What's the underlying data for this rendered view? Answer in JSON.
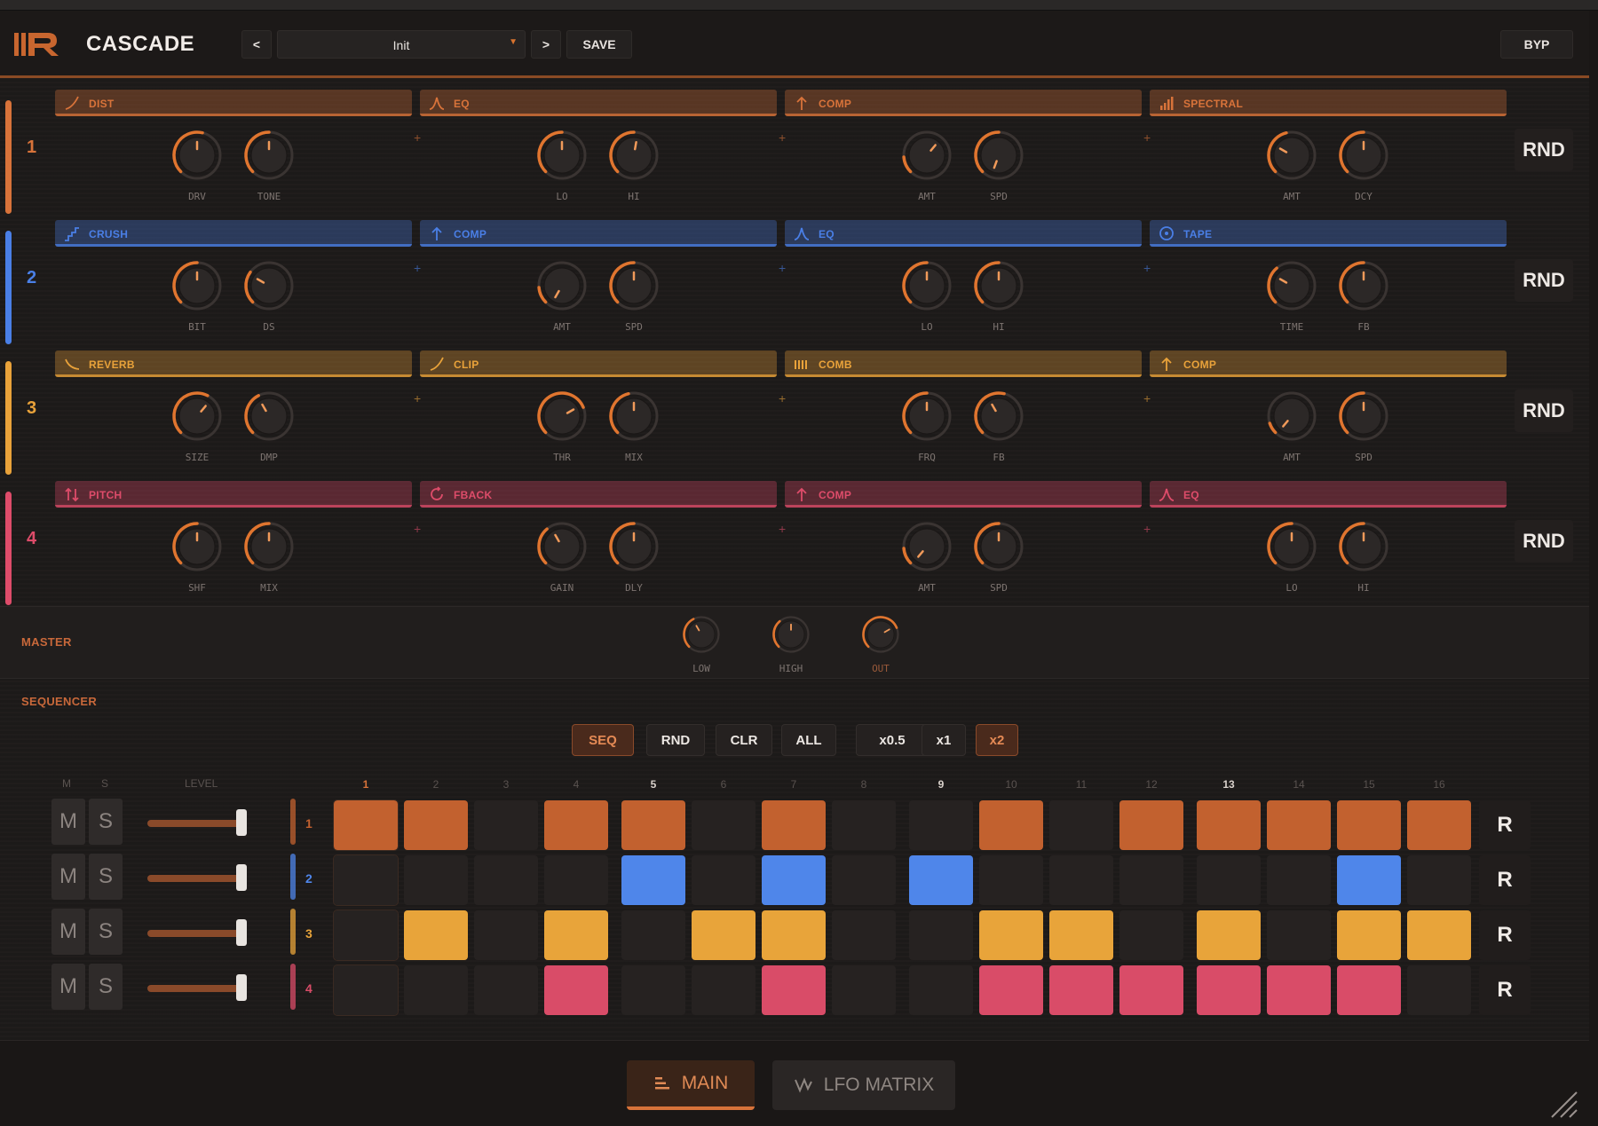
{
  "header": {
    "brand": "CASCADE",
    "prev_label": "<",
    "next_label": ">",
    "preset_name": "Init",
    "save_label": "SAVE",
    "bypass_label": "BYP"
  },
  "rows": [
    {
      "num": "1",
      "color": "#d8733a",
      "rnd_label": "RND",
      "slots": [
        {
          "name": "DIST",
          "icon": "ramp-icon",
          "knobs": [
            {
              "label": "DRV"
            },
            {
              "label": "TONE"
            }
          ]
        },
        {
          "name": "EQ",
          "icon": "bell-curve-icon",
          "knobs": [
            {
              "label": "LO"
            },
            {
              "label": "HI"
            }
          ]
        },
        {
          "name": "COMP",
          "icon": "arrow-up-icon",
          "knobs": [
            {
              "label": "AMT"
            },
            {
              "label": "SPD"
            }
          ]
        },
        {
          "name": "SPECTRAL",
          "icon": "bars-icon",
          "knobs": [
            {
              "label": "AMT"
            },
            {
              "label": "DCY"
            }
          ]
        }
      ]
    },
    {
      "num": "2",
      "color": "#4a7fe6",
      "rnd_label": "RND",
      "slots": [
        {
          "name": "CRUSH",
          "icon": "stairs-icon",
          "knobs": [
            {
              "label": "BIT"
            },
            {
              "label": "DS"
            }
          ]
        },
        {
          "name": "COMP",
          "icon": "arrow-up-icon",
          "knobs": [
            {
              "label": "AMT"
            },
            {
              "label": "SPD"
            }
          ]
        },
        {
          "name": "EQ",
          "icon": "bell-curve-icon",
          "knobs": [
            {
              "label": "LO"
            },
            {
              "label": "HI"
            }
          ]
        },
        {
          "name": "TAPE",
          "icon": "reel-icon",
          "knobs": [
            {
              "label": "TIME"
            },
            {
              "label": "FB"
            }
          ]
        }
      ]
    },
    {
      "num": "3",
      "color": "#e9a23a",
      "rnd_label": "RND",
      "slots": [
        {
          "name": "REVERB",
          "icon": "decay-icon",
          "knobs": [
            {
              "label": "SIZE"
            },
            {
              "label": "DMP"
            }
          ]
        },
        {
          "name": "CLIP",
          "icon": "ramp-icon",
          "knobs": [
            {
              "label": "THR"
            },
            {
              "label": "MIX"
            }
          ]
        },
        {
          "name": "COMB",
          "icon": "comb-icon",
          "knobs": [
            {
              "label": "FRQ"
            },
            {
              "label": "FB"
            }
          ]
        },
        {
          "name": "COMP",
          "icon": "arrow-up-icon",
          "knobs": [
            {
              "label": "AMT"
            },
            {
              "label": "SPD"
            }
          ]
        }
      ]
    },
    {
      "num": "4",
      "color": "#de4c6a",
      "rnd_label": "RND",
      "slots": [
        {
          "name": "PITCH",
          "icon": "pitch-arrows-icon",
          "knobs": [
            {
              "label": "SHF"
            },
            {
              "label": "MIX"
            }
          ]
        },
        {
          "name": "FBACK",
          "icon": "loop-icon",
          "knobs": [
            {
              "label": "GAIN"
            },
            {
              "label": "DLY"
            }
          ]
        },
        {
          "name": "COMP",
          "icon": "arrow-up-icon",
          "knobs": [
            {
              "label": "AMT"
            },
            {
              "label": "SPD"
            }
          ]
        },
        {
          "name": "EQ",
          "icon": "bell-curve-icon",
          "knobs": [
            {
              "label": "LO"
            },
            {
              "label": "HI"
            }
          ]
        }
      ]
    }
  ],
  "master": {
    "title": "MASTER",
    "knobs": [
      {
        "label": "LOW"
      },
      {
        "label": "HIGH"
      },
      {
        "label": "OUT"
      }
    ]
  },
  "sequencer": {
    "title": "SEQUENCER",
    "buttons": [
      {
        "label": "SEQ",
        "active": true
      },
      {
        "label": "RND",
        "active": false
      },
      {
        "label": "CLR",
        "active": false
      },
      {
        "label": "ALL",
        "active": false
      },
      {
        "label": "x0.5",
        "active": false
      },
      {
        "label": "x1",
        "active": false
      },
      {
        "label": "x2",
        "active": true
      }
    ],
    "col_m": "M",
    "col_s": "S",
    "col_level": "LEVEL",
    "steps": [
      "1",
      "2",
      "3",
      "4",
      "5",
      "6",
      "7",
      "8",
      "9",
      "10",
      "11",
      "12",
      "13",
      "14",
      "15",
      "16"
    ],
    "mute_label": "M",
    "solo_label": "S",
    "reset_label": "R",
    "tracks": [
      {
        "num": "1",
        "color": "#c2612f",
        "pattern": [
          1,
          1,
          0,
          1,
          1,
          0,
          1,
          0,
          0,
          1,
          0,
          1,
          1,
          1,
          1,
          1
        ]
      },
      {
        "num": "2",
        "color": "#4f86ea",
        "pattern": [
          0,
          0,
          0,
          0,
          1,
          0,
          1,
          0,
          1,
          0,
          0,
          0,
          0,
          0,
          1,
          0
        ]
      },
      {
        "num": "3",
        "color": "#e8a43a",
        "pattern": [
          0,
          1,
          0,
          1,
          0,
          1,
          1,
          0,
          0,
          1,
          1,
          0,
          1,
          0,
          1,
          1
        ]
      },
      {
        "num": "4",
        "color": "#d94c68",
        "pattern": [
          0,
          0,
          0,
          1,
          0,
          0,
          1,
          0,
          0,
          1,
          1,
          1,
          1,
          1,
          1,
          0
        ]
      }
    ]
  },
  "footer": {
    "main_tab": "MAIN",
    "lfo_tab": "LFO MATRIX"
  }
}
